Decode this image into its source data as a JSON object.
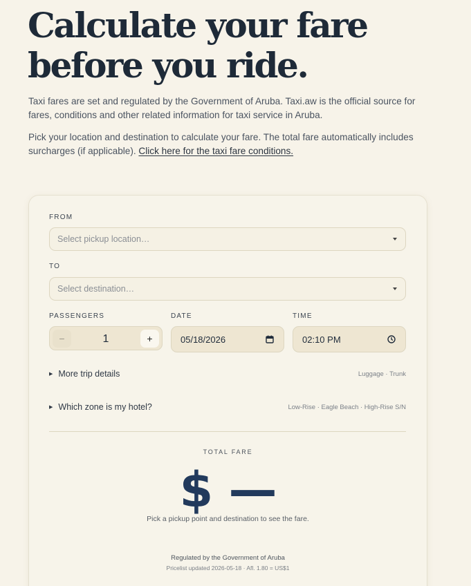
{
  "hero": {
    "title_line1": "Calculate your fare",
    "title_line2": "before you ride."
  },
  "intro": {
    "paragraph1": "Taxi fares are set and regulated by the Government of Aruba. Taxi.aw is the official source for fares, conditions and other related information for taxi service in Aruba.",
    "paragraph2_text": "Pick your location and destination to calculate your fare. The total fare automatically includes surcharges (if applicable). ",
    "paragraph2_link": "Click here for the taxi fare conditions."
  },
  "form": {
    "from_label": "FROM",
    "from_placeholder": "Select pickup location…",
    "to_label": "TO",
    "to_placeholder": "Select destination…",
    "passengers_label": "PASSENGERS",
    "passengers_minus": "−",
    "passengers_value": "1",
    "passengers_plus": "+",
    "date_label": "DATE",
    "date_value": "05/18/2026",
    "time_label": "TIME",
    "time_value": "02:10 PM",
    "more_details_label": "More trip details",
    "more_details_hint": "Luggage · Trunk",
    "zone_label": "Which zone is my hotel?",
    "zone_hint": "Low-Rise · Eagle Beach · High-Rise S/N"
  },
  "result": {
    "total_label": "TOTAL FARE",
    "fare_value": "$ —",
    "fare_hint": "Pick a pickup point and destination to see the fare.",
    "regulated": "Regulated by the Government of Aruba",
    "pricelist": "Pricelist updated 2026-05-18 · Afl. 1.80 = US$1"
  },
  "icons": {
    "caret": "caret-down-icon",
    "calendar": "calendar-icon",
    "clock": "clock-icon",
    "disclosure": "triangle-right-icon"
  },
  "colors": {
    "background": "#f7f3e9",
    "heading": "#1e2a38",
    "fare": "#223a5c",
    "field": "#eee6d2"
  }
}
